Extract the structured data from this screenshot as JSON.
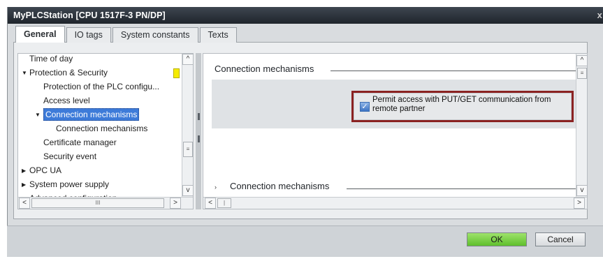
{
  "window": {
    "title": "MyPLCStation [CPU 1517F-3 PN/DP]",
    "close_glyph": "x"
  },
  "tabs": [
    {
      "label": "General",
      "active": true
    },
    {
      "label": "IO tags",
      "active": false
    },
    {
      "label": "System constants",
      "active": false
    },
    {
      "label": "Texts",
      "active": false
    }
  ],
  "tree": {
    "items": [
      {
        "label": "Time of day",
        "indent": 1,
        "expander": ""
      },
      {
        "label": "Protection & Security",
        "indent": 0,
        "expander": "▼"
      },
      {
        "label": "Protection of the PLC configu...",
        "indent": 2,
        "expander": ""
      },
      {
        "label": "Access level",
        "indent": 2,
        "expander": ""
      },
      {
        "label": "Connection mechanisms",
        "indent": 2,
        "expander": "▼",
        "selected": true
      },
      {
        "label": "Connection mechanisms",
        "indent": 3,
        "expander": ""
      },
      {
        "label": "Certificate manager",
        "indent": 2,
        "expander": ""
      },
      {
        "label": "Security event",
        "indent": 2,
        "expander": ""
      },
      {
        "label": "OPC UA",
        "indent": 0,
        "expander": "▶"
      },
      {
        "label": "System power supply",
        "indent": 0,
        "expander": "▶"
      },
      {
        "label": "Advanced configuration",
        "indent": 0,
        "expander": "▶"
      }
    ],
    "flag_color": "#f5ec00"
  },
  "content": {
    "section_title": "Connection mechanisms",
    "checkbox_label_line1": "Permit access with PUT/GET communication from",
    "checkbox_label_line2": "remote partner",
    "checkbox_checked": true,
    "subsection_title": "Connection mechanisms",
    "highlight_color": "#8b2222"
  },
  "buttons": {
    "ok": "OK",
    "cancel": "Cancel",
    "ok_color": "#6cc93a"
  },
  "icons": {
    "scroll_up": "^",
    "scroll_down": "v",
    "scroll_left": "<",
    "scroll_right": ">",
    "thumb_grip": "III"
  }
}
